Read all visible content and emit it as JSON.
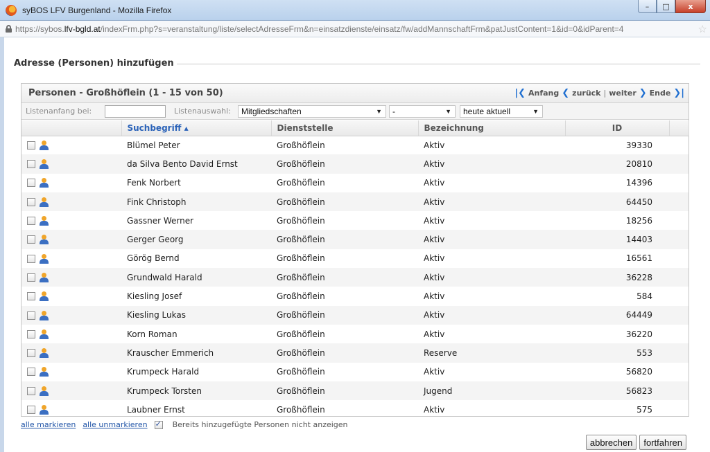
{
  "window": {
    "title": "syBOS LFV Burgenland - Mozilla Firefox",
    "min": "–",
    "max": "□",
    "close": "x"
  },
  "browser": {
    "url_prefix": "https://sybos.",
    "url_domain": "lfv-bgld.at",
    "url_rest": "/indexFrm.php?s=veranstaltung/liste/selectAdresseFrm&n=einsatzdienste/einsatz/fw/addMannschaftFrm&patJustContent=1&id=0&idParent=4"
  },
  "page": {
    "legend": "Adresse (Personen) hinzufügen"
  },
  "panel": {
    "title": "Personen - Großhöflein (1 - 15 von 50)",
    "pager": {
      "first": "Anfang",
      "prev": "zurück",
      "sep": "|",
      "next": "weiter",
      "last": "Ende"
    }
  },
  "filters": {
    "start_label": "Listenanfang bei:",
    "start_value": "",
    "selection_label": "Listenauswahl:",
    "selection_value": "Mitgliedschaften",
    "second_value": "-",
    "date_value": "heute aktuell"
  },
  "table": {
    "headers": {
      "name": "Suchbegriff ▴",
      "dept": "Dienststelle",
      "role": "Bezeichnung",
      "id": "ID"
    },
    "rows": [
      {
        "name": "Blümel Peter",
        "dept": "Großhöflein",
        "role": "Aktiv",
        "id": "39330"
      },
      {
        "name": "da Silva Bento David Ernst",
        "dept": "Großhöflein",
        "role": "Aktiv",
        "id": "20810"
      },
      {
        "name": "Fenk Norbert",
        "dept": "Großhöflein",
        "role": "Aktiv",
        "id": "14396"
      },
      {
        "name": "Fink Christoph",
        "dept": "Großhöflein",
        "role": "Aktiv",
        "id": "64450"
      },
      {
        "name": "Gassner Werner",
        "dept": "Großhöflein",
        "role": "Aktiv",
        "id": "18256"
      },
      {
        "name": "Gerger Georg",
        "dept": "Großhöflein",
        "role": "Aktiv",
        "id": "14403"
      },
      {
        "name": "Görög Bernd",
        "dept": "Großhöflein",
        "role": "Aktiv",
        "id": "16561"
      },
      {
        "name": "Grundwald Harald",
        "dept": "Großhöflein",
        "role": "Aktiv",
        "id": "36228"
      },
      {
        "name": "Kiesling Josef",
        "dept": "Großhöflein",
        "role": "Aktiv",
        "id": "584"
      },
      {
        "name": "Kiesling Lukas",
        "dept": "Großhöflein",
        "role": "Aktiv",
        "id": "64449"
      },
      {
        "name": "Korn Roman",
        "dept": "Großhöflein",
        "role": "Aktiv",
        "id": "36220"
      },
      {
        "name": "Krauscher Emmerich",
        "dept": "Großhöflein",
        "role": "Reserve",
        "id": "553"
      },
      {
        "name": "Krumpeck Harald",
        "dept": "Großhöflein",
        "role": "Aktiv",
        "id": "56820"
      },
      {
        "name": "Krumpeck Torsten",
        "dept": "Großhöflein",
        "role": "Jugend",
        "id": "56823"
      },
      {
        "name": "Laubner Ernst",
        "dept": "Großhöflein",
        "role": "Aktiv",
        "id": "575"
      }
    ]
  },
  "footer": {
    "mark_all": "alle markieren",
    "unmark_all": "alle unmarkieren",
    "hide_added_label": "Bereits hinzugefügte Personen nicht anzeigen",
    "hide_added_checked": true,
    "cancel": "abbrechen",
    "continue": "fortfahren"
  }
}
